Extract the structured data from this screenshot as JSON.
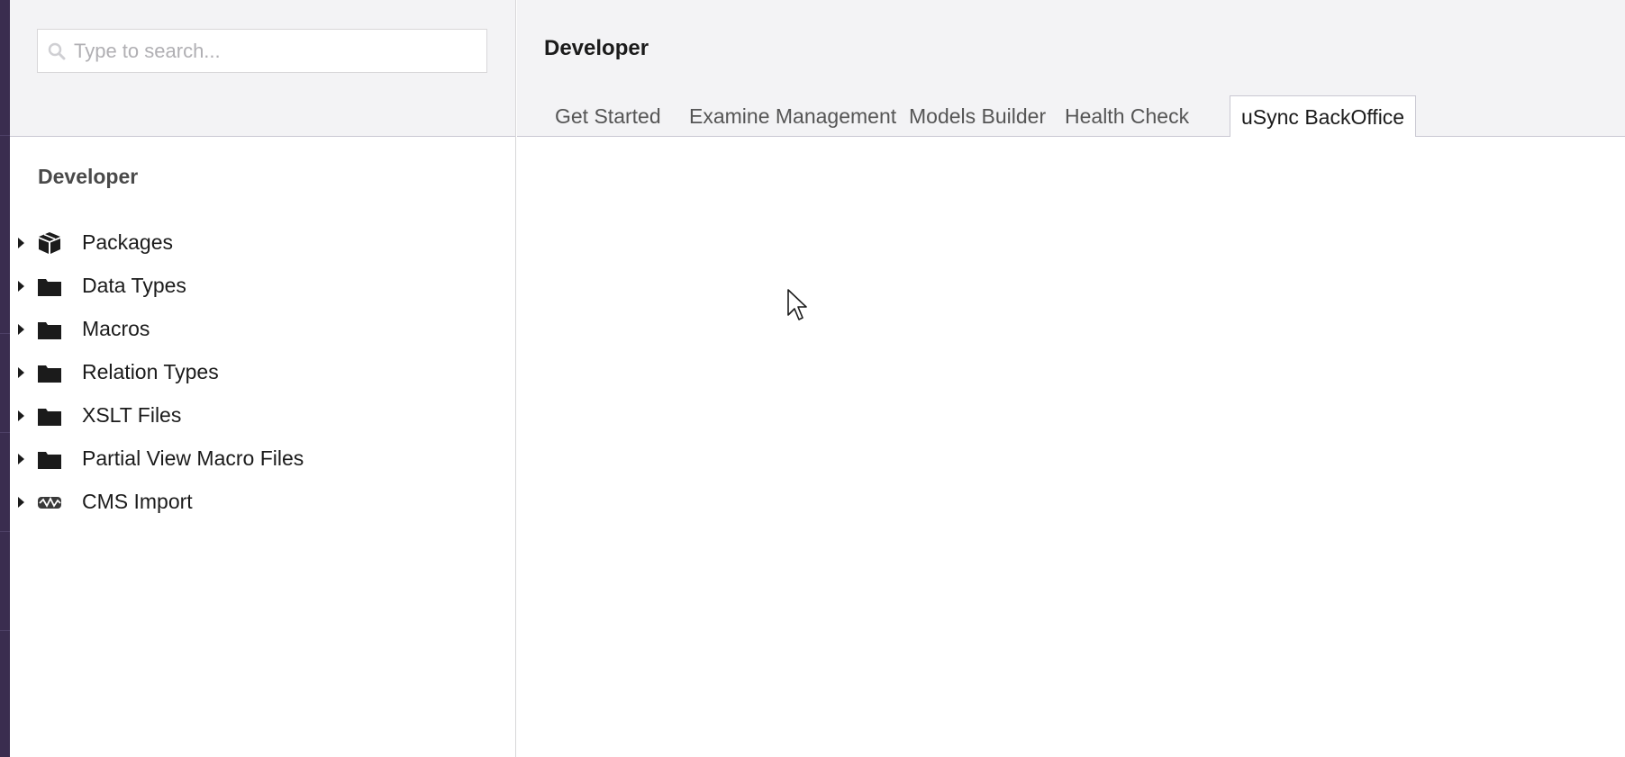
{
  "search": {
    "placeholder": "Type to search..."
  },
  "tree": {
    "title": "Developer",
    "items": [
      {
        "label": "Packages",
        "icon": "package-icon"
      },
      {
        "label": "Data Types",
        "icon": "folder-icon"
      },
      {
        "label": "Macros",
        "icon": "folder-icon"
      },
      {
        "label": "Relation Types",
        "icon": "folder-icon"
      },
      {
        "label": "XSLT Files",
        "icon": "folder-icon"
      },
      {
        "label": "Partial View Macro Files",
        "icon": "folder-icon"
      },
      {
        "label": "CMS Import",
        "icon": "cms-import-icon"
      }
    ]
  },
  "header": {
    "title": "Developer",
    "tabs": [
      {
        "label": "Get Started",
        "active": false
      },
      {
        "label": "Examine Management",
        "active": false
      },
      {
        "label": "Models Builder",
        "active": false
      },
      {
        "label": "Health Check",
        "active": false
      },
      {
        "label": "uSync BackOffice",
        "active": true
      }
    ]
  },
  "colors": {
    "header_bg": "#f3f3f5",
    "edge_strip": "#3a2d4f",
    "border": "#c9c8d2"
  }
}
